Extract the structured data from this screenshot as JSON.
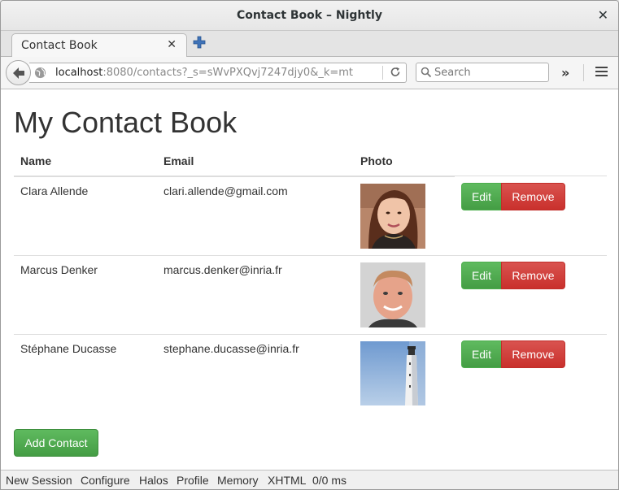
{
  "window": {
    "title": "Contact Book – Nightly"
  },
  "tab": {
    "label": "Contact Book"
  },
  "navbar": {
    "url_host": "localhost",
    "url_rest": ":8080/contacts?_s=sWvPXQvj7247djy0&_k=mt",
    "search_placeholder": "Search"
  },
  "page": {
    "title": "My Contact Book",
    "columns": {
      "name": "Name",
      "email": "Email",
      "photo": "Photo"
    },
    "contacts": [
      {
        "name": "Clara Allende",
        "email": "clari.allende@gmail.com",
        "photo_icon": "woman-portrait",
        "edit": "Edit",
        "remove": "Remove"
      },
      {
        "name": "Marcus Denker",
        "email": "marcus.denker@inria.fr",
        "photo_icon": "man-portrait",
        "edit": "Edit",
        "remove": "Remove"
      },
      {
        "name": "Stéphane Ducasse",
        "email": "stephane.ducasse@inria.fr",
        "photo_icon": "lighthouse",
        "edit": "Edit",
        "remove": "Remove"
      }
    ],
    "add_button": "Add Contact"
  },
  "statusbar": {
    "items": [
      "New Session",
      "Configure",
      "Halos",
      "Profile",
      "Memory",
      "XHTML",
      "0/0 ms"
    ]
  },
  "colors": {
    "success": "#5cb85c",
    "danger": "#d9534f",
    "text": "#333333"
  }
}
